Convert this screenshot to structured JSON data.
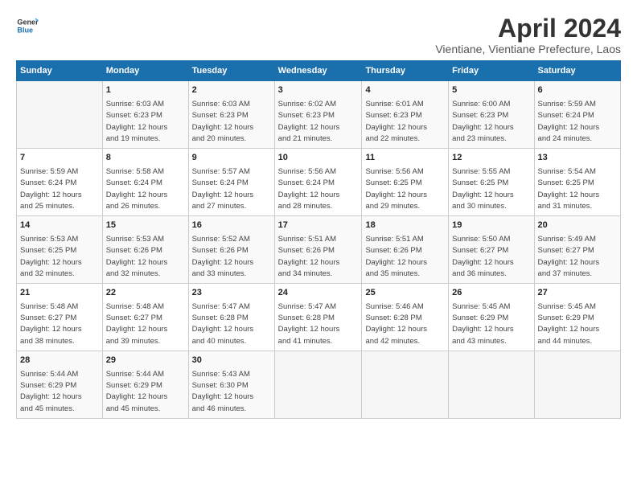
{
  "logo": {
    "line1": "General",
    "line2": "Blue"
  },
  "title": "April 2024",
  "subtitle": "Vientiane, Vientiane Prefecture, Laos",
  "days_header": [
    "Sunday",
    "Monday",
    "Tuesday",
    "Wednesday",
    "Thursday",
    "Friday",
    "Saturday"
  ],
  "weeks": [
    [
      {
        "num": "",
        "lines": []
      },
      {
        "num": "1",
        "lines": [
          "Sunrise: 6:03 AM",
          "Sunset: 6:23 PM",
          "Daylight: 12 hours",
          "and 19 minutes."
        ]
      },
      {
        "num": "2",
        "lines": [
          "Sunrise: 6:03 AM",
          "Sunset: 6:23 PM",
          "Daylight: 12 hours",
          "and 20 minutes."
        ]
      },
      {
        "num": "3",
        "lines": [
          "Sunrise: 6:02 AM",
          "Sunset: 6:23 PM",
          "Daylight: 12 hours",
          "and 21 minutes."
        ]
      },
      {
        "num": "4",
        "lines": [
          "Sunrise: 6:01 AM",
          "Sunset: 6:23 PM",
          "Daylight: 12 hours",
          "and 22 minutes."
        ]
      },
      {
        "num": "5",
        "lines": [
          "Sunrise: 6:00 AM",
          "Sunset: 6:23 PM",
          "Daylight: 12 hours",
          "and 23 minutes."
        ]
      },
      {
        "num": "6",
        "lines": [
          "Sunrise: 5:59 AM",
          "Sunset: 6:24 PM",
          "Daylight: 12 hours",
          "and 24 minutes."
        ]
      }
    ],
    [
      {
        "num": "7",
        "lines": [
          "Sunrise: 5:59 AM",
          "Sunset: 6:24 PM",
          "Daylight: 12 hours",
          "and 25 minutes."
        ]
      },
      {
        "num": "8",
        "lines": [
          "Sunrise: 5:58 AM",
          "Sunset: 6:24 PM",
          "Daylight: 12 hours",
          "and 26 minutes."
        ]
      },
      {
        "num": "9",
        "lines": [
          "Sunrise: 5:57 AM",
          "Sunset: 6:24 PM",
          "Daylight: 12 hours",
          "and 27 minutes."
        ]
      },
      {
        "num": "10",
        "lines": [
          "Sunrise: 5:56 AM",
          "Sunset: 6:24 PM",
          "Daylight: 12 hours",
          "and 28 minutes."
        ]
      },
      {
        "num": "11",
        "lines": [
          "Sunrise: 5:56 AM",
          "Sunset: 6:25 PM",
          "Daylight: 12 hours",
          "and 29 minutes."
        ]
      },
      {
        "num": "12",
        "lines": [
          "Sunrise: 5:55 AM",
          "Sunset: 6:25 PM",
          "Daylight: 12 hours",
          "and 30 minutes."
        ]
      },
      {
        "num": "13",
        "lines": [
          "Sunrise: 5:54 AM",
          "Sunset: 6:25 PM",
          "Daylight: 12 hours",
          "and 31 minutes."
        ]
      }
    ],
    [
      {
        "num": "14",
        "lines": [
          "Sunrise: 5:53 AM",
          "Sunset: 6:25 PM",
          "Daylight: 12 hours",
          "and 32 minutes."
        ]
      },
      {
        "num": "15",
        "lines": [
          "Sunrise: 5:53 AM",
          "Sunset: 6:26 PM",
          "Daylight: 12 hours",
          "and 32 minutes."
        ]
      },
      {
        "num": "16",
        "lines": [
          "Sunrise: 5:52 AM",
          "Sunset: 6:26 PM",
          "Daylight: 12 hours",
          "and 33 minutes."
        ]
      },
      {
        "num": "17",
        "lines": [
          "Sunrise: 5:51 AM",
          "Sunset: 6:26 PM",
          "Daylight: 12 hours",
          "and 34 minutes."
        ]
      },
      {
        "num": "18",
        "lines": [
          "Sunrise: 5:51 AM",
          "Sunset: 6:26 PM",
          "Daylight: 12 hours",
          "and 35 minutes."
        ]
      },
      {
        "num": "19",
        "lines": [
          "Sunrise: 5:50 AM",
          "Sunset: 6:27 PM",
          "Daylight: 12 hours",
          "and 36 minutes."
        ]
      },
      {
        "num": "20",
        "lines": [
          "Sunrise: 5:49 AM",
          "Sunset: 6:27 PM",
          "Daylight: 12 hours",
          "and 37 minutes."
        ]
      }
    ],
    [
      {
        "num": "21",
        "lines": [
          "Sunrise: 5:48 AM",
          "Sunset: 6:27 PM",
          "Daylight: 12 hours",
          "and 38 minutes."
        ]
      },
      {
        "num": "22",
        "lines": [
          "Sunrise: 5:48 AM",
          "Sunset: 6:27 PM",
          "Daylight: 12 hours",
          "and 39 minutes."
        ]
      },
      {
        "num": "23",
        "lines": [
          "Sunrise: 5:47 AM",
          "Sunset: 6:28 PM",
          "Daylight: 12 hours",
          "and 40 minutes."
        ]
      },
      {
        "num": "24",
        "lines": [
          "Sunrise: 5:47 AM",
          "Sunset: 6:28 PM",
          "Daylight: 12 hours",
          "and 41 minutes."
        ]
      },
      {
        "num": "25",
        "lines": [
          "Sunrise: 5:46 AM",
          "Sunset: 6:28 PM",
          "Daylight: 12 hours",
          "and 42 minutes."
        ]
      },
      {
        "num": "26",
        "lines": [
          "Sunrise: 5:45 AM",
          "Sunset: 6:29 PM",
          "Daylight: 12 hours",
          "and 43 minutes."
        ]
      },
      {
        "num": "27",
        "lines": [
          "Sunrise: 5:45 AM",
          "Sunset: 6:29 PM",
          "Daylight: 12 hours",
          "and 44 minutes."
        ]
      }
    ],
    [
      {
        "num": "28",
        "lines": [
          "Sunrise: 5:44 AM",
          "Sunset: 6:29 PM",
          "Daylight: 12 hours",
          "and 45 minutes."
        ]
      },
      {
        "num": "29",
        "lines": [
          "Sunrise: 5:44 AM",
          "Sunset: 6:29 PM",
          "Daylight: 12 hours",
          "and 45 minutes."
        ]
      },
      {
        "num": "30",
        "lines": [
          "Sunrise: 5:43 AM",
          "Sunset: 6:30 PM",
          "Daylight: 12 hours",
          "and 46 minutes."
        ]
      },
      {
        "num": "",
        "lines": []
      },
      {
        "num": "",
        "lines": []
      },
      {
        "num": "",
        "lines": []
      },
      {
        "num": "",
        "lines": []
      }
    ]
  ]
}
